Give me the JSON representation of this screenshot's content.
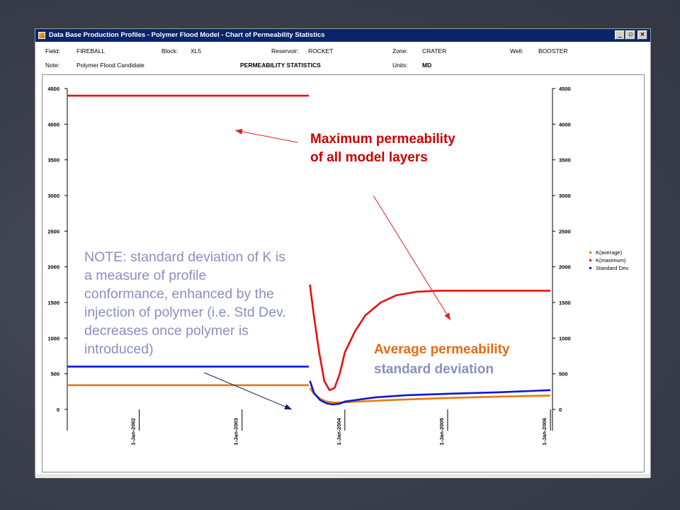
{
  "window": {
    "title": "Data Base Production Profiles - Polymer Flood Model - Chart of Permeability Statistics",
    "min_glyph": "_",
    "max_glyph": "▫",
    "close_glyph": "×"
  },
  "info": {
    "field_label": "Field:",
    "field_value": "FIREBALL",
    "block_label": "Block:",
    "block_value": "XL5",
    "reservoir_label": "Reservoir:",
    "reservoir_value": "ROCKET",
    "zone_label": "Zone:",
    "zone_value": "CRATER",
    "well_label": "Well:",
    "well_value": "BOOSTER",
    "note_label": "Note:",
    "note_value": "Polymer Flood Candidate",
    "heading": "PERMEABILITY STATISTICS",
    "units_label": "Units:",
    "units_value": "MD"
  },
  "annotations": {
    "max_text": "Maximum permeability of all model layers",
    "avg_text": "Average permeability",
    "std_text": "standard deviation",
    "note_text": "NOTE: standard deviation of K is a measure of profile conformance, enhanced by the injection of polymer (i.e. Std Dev. decreases once polymer is introduced)"
  },
  "colors": {
    "kavg": "#e87a10",
    "kmax": "#e81010",
    "std": "#0a18d8",
    "arrow_red": "#e02020",
    "arrow_navy": "#102070"
  },
  "chart_data": {
    "type": "line",
    "x_tick_labels": [
      "1-Jan-2002",
      "1-Jan-2003",
      "1-Jan-2004",
      "1-Jan-2005",
      "1-Jan-2006"
    ],
    "x_ticks": [
      2002,
      2003,
      2004,
      2005,
      2006
    ],
    "xlim": [
      2001.3,
      2006.02
    ],
    "ylim": [
      0,
      4500
    ],
    "y_ticks": [
      0,
      500,
      1000,
      1500,
      2000,
      2500,
      3000,
      3500,
      4000,
      4500
    ],
    "legend": [
      "K(average)",
      "K(maximum)",
      "Standard Dev."
    ],
    "legend_position": "right",
    "series": [
      {
        "name": "K(average)",
        "points": [
          [
            2001.3,
            340
          ],
          [
            2003.65,
            340
          ],
          [
            2003.66,
            300
          ],
          [
            2003.7,
            220
          ],
          [
            2003.76,
            150
          ],
          [
            2003.82,
            110
          ],
          [
            2003.9,
            95
          ],
          [
            2004.0,
            100
          ],
          [
            2004.5,
            135
          ],
          [
            2005.0,
            160
          ],
          [
            2005.5,
            180
          ],
          [
            2006.0,
            195
          ]
        ]
      },
      {
        "name": "K(maximum)",
        "points": [
          [
            2001.3,
            4400
          ],
          [
            2003.65,
            4400
          ],
          [
            2003.66,
            1750
          ],
          [
            2003.7,
            1300
          ],
          [
            2003.75,
            800
          ],
          [
            2003.8,
            400
          ],
          [
            2003.85,
            270
          ],
          [
            2003.9,
            300
          ],
          [
            2003.95,
            500
          ],
          [
            2004.0,
            800
          ],
          [
            2004.1,
            1100
          ],
          [
            2004.2,
            1320
          ],
          [
            2004.35,
            1500
          ],
          [
            2004.5,
            1600
          ],
          [
            2004.7,
            1650
          ],
          [
            2004.9,
            1665
          ],
          [
            2006.0,
            1665
          ]
        ]
      },
      {
        "name": "Standard Dev.",
        "points": [
          [
            2001.3,
            600
          ],
          [
            2003.65,
            600
          ],
          [
            2003.66,
            400
          ],
          [
            2003.7,
            230
          ],
          [
            2003.76,
            130
          ],
          [
            2003.82,
            85
          ],
          [
            2003.88,
            70
          ],
          [
            2003.95,
            80
          ],
          [
            2004.0,
            110
          ],
          [
            2004.3,
            170
          ],
          [
            2004.6,
            200
          ],
          [
            2005.0,
            220
          ],
          [
            2005.5,
            240
          ],
          [
            2006.0,
            270
          ]
        ]
      }
    ]
  }
}
